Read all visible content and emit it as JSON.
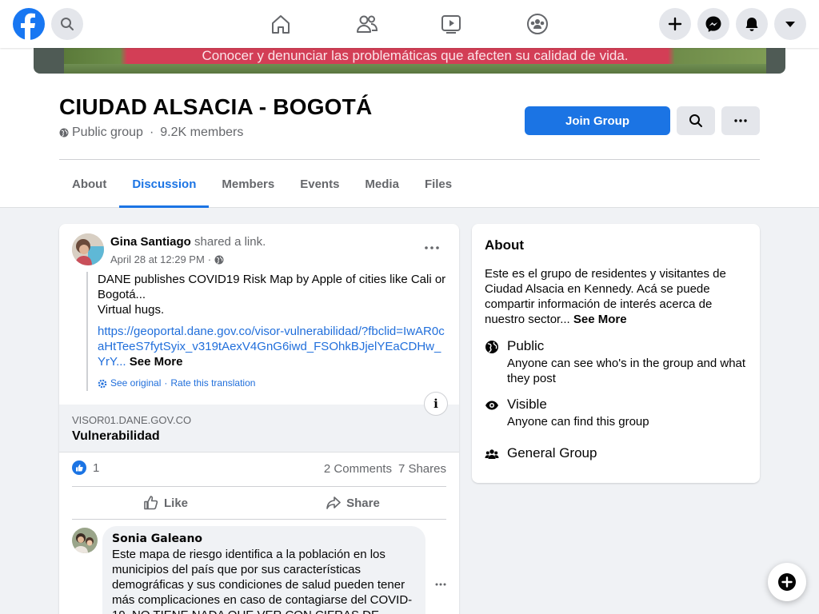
{
  "nav": {
    "logo": "facebook-logo",
    "search_icon": "search-icon",
    "center_icons": [
      "home-icon",
      "friends-icon",
      "watch-icon",
      "groups-icon"
    ],
    "right_icons": [
      "create-icon",
      "messenger-icon",
      "notifications-icon",
      "account-menu-icon"
    ]
  },
  "cover": {
    "text": "Conocer y denunciar las problemáticas que afecten su calidad de vida."
  },
  "group": {
    "name": "CIUDAD ALSACIA - BOGOTÁ",
    "privacy": "Public group",
    "separator": "·",
    "members": "9.2K members",
    "join_label": "Join Group"
  },
  "tabs": [
    {
      "label": "About",
      "active": false
    },
    {
      "label": "Discussion",
      "active": true
    },
    {
      "label": "Members",
      "active": false
    },
    {
      "label": "Events",
      "active": false
    },
    {
      "label": "Media",
      "active": false
    },
    {
      "label": "Files",
      "active": false
    }
  ],
  "post": {
    "author": "Gina Santiago",
    "action": "shared a link.",
    "time": "April 28 at 12:29 PM",
    "time_sep": "·",
    "text_line1": "DANE publishes COVID19 Risk Map by Apple of cities like Cali or Bogotá...",
    "text_line2": "Virtual hugs.",
    "link": "https://geoportal.dane.gov.co/visor-vulnerabilidad/?fbclid=IwAR0caHtTeeS7fytSyix_v319tAexV4GnG6iwd_FSOhkBJjelYEaCDHw_YrY...",
    "see_more": "See More",
    "see_original": "See original",
    "translate_sep": "·",
    "rate_translation": "Rate this translation",
    "info_glyph": "i",
    "preview_domain": "VISOR01.DANE.GOV.CO",
    "preview_title": "Vulnerabilidad",
    "reaction_count": "1",
    "comments": "2 Comments",
    "shares": "7 Shares",
    "like_label": "Like",
    "share_label": "Share"
  },
  "comment": {
    "author": "Sonia Galeano",
    "text": "Este mapa de riesgo identifica a la población en los municipios del país que por sus características demográficas y sus condiciones de salud pueden tener más complicaciones en caso de contagiarse del COVID-19. NO TIENE NADA QUE VER CON CIFRAS DE"
  },
  "about": {
    "heading": "About",
    "description": "Este es el grupo de residentes y visitantes de Ciudad Alsacia en Kennedy. Acá se puede compartir información de interés acerca de nuestro sector...",
    "see_more": "See More",
    "public_title": "Public",
    "public_desc": "Anyone can see who's in the group and what they post",
    "visible_title": "Visible",
    "visible_desc": "Anyone can find this group",
    "type": "General Group"
  },
  "colors": {
    "brand": "#1877f2",
    "button": "#1b74e4",
    "link": "#216fdb"
  }
}
